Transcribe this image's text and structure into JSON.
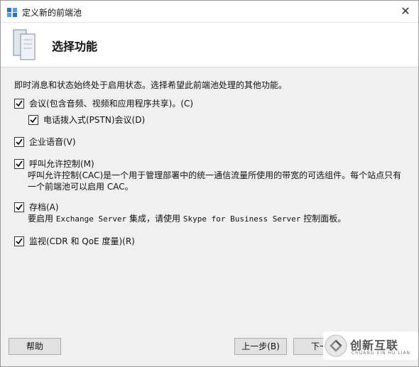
{
  "window": {
    "title": "定义新的前端池",
    "close_symbol": "✕"
  },
  "header": {
    "title": "选择功能"
  },
  "intro": "即时消息和状态始终处于启用状态。选择希望此前端池处理的其他功能。",
  "options": [
    {
      "label": "会议(包含音频、视频和应用程序共享)。(C)",
      "checked": true
    },
    {
      "label": "电话拨入式(PSTN)会议(D)",
      "checked": true
    },
    {
      "label": "企业语音(V)",
      "checked": true
    },
    {
      "label": "呼叫允许控制(M)",
      "checked": true
    },
    {
      "label": "存档(A)",
      "checked": true
    },
    {
      "label": "监视(CDR 和 QoE 度量)(R)",
      "checked": true
    }
  ],
  "descriptions": {
    "cac_line1": "呼叫允许控制(CAC)是一个用于管理部署中的统一通信流量所使用的带宽的可选组件。每个站点只有",
    "cac_line2": "一个前端池可以启用 CAC。",
    "archiving_prefix": "要启用",
    "archiving_product1": "Exchange Server",
    "archiving_middle": "集成，请使用",
    "archiving_product2": "Skype for Business Server",
    "archiving_suffix": "控制面板。"
  },
  "footer": {
    "help_label": "帮助",
    "back_label": "上一步(B)",
    "next_label": "下一"
  },
  "watermark": {
    "text": "创新互联",
    "sub": "CHUANG XIN HU LIAN"
  },
  "colors": {
    "accent": "#1e6fd9",
    "button_bg": "#e1e1e1",
    "panel_bg": "#f0f0f0"
  }
}
